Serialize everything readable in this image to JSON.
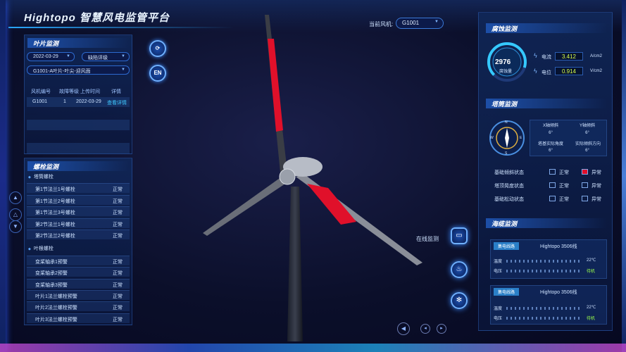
{
  "app": {
    "title": "Hightopo 智慧风电监管平台"
  },
  "turbine_selector": {
    "label": "当前风机:",
    "value": "G1001"
  },
  "blade_panel": {
    "title": "叶片监测",
    "date_value": "2022-03-29",
    "fault_value": "缺陷评级",
    "blade_select": "G1001-A叶片-叶尖-迎风面",
    "columns": [
      "风机编号",
      "故障等级",
      "上传时间",
      "详情"
    ],
    "rows": [
      {
        "id": "G1001",
        "level": "1",
        "time": "2022-03-29",
        "detail": "查看详情"
      }
    ]
  },
  "bolt_panel": {
    "title": "螺栓监测",
    "tower_section": "塔筒螺栓",
    "tower_rows": [
      {
        "name": "第1节法兰1号螺栓",
        "status": "正常"
      },
      {
        "name": "第1节法兰2号螺栓",
        "status": "正常"
      },
      {
        "name": "第1节法兰3号螺栓",
        "status": "正常"
      },
      {
        "name": "第2节法兰1号螺栓",
        "status": "正常"
      },
      {
        "name": "第2节法兰2号螺栓",
        "status": "正常"
      }
    ],
    "blade_section": "叶根螺栓",
    "blade_rows": [
      {
        "name": "变桨轴承1预警",
        "status": "正常"
      },
      {
        "name": "变桨轴承2预警",
        "status": "正常"
      },
      {
        "name": "变桨轴承3预警",
        "status": "正常"
      },
      {
        "name": "叶片1法兰螺栓预警",
        "status": "正常"
      },
      {
        "name": "叶片2法兰螺栓预警",
        "status": "正常"
      },
      {
        "name": "叶片3法兰螺栓预警",
        "status": "正常"
      }
    ]
  },
  "tool_buttons": {
    "refresh": "⟳",
    "lang": "EN"
  },
  "corrosion_panel": {
    "title": "腐蚀监测",
    "gauge_value": "2976",
    "gauge_label": "腐蚀量",
    "current_label": "电流",
    "current_value": "3.412",
    "current_unit": "A/cm2",
    "potential_label": "电位",
    "potential_value": "0.914",
    "potential_unit": "V/cm2"
  },
  "tower_panel": {
    "title": "塔筒监测",
    "tilt_headers": [
      "X轴倾斜",
      "Y轴倾斜"
    ],
    "tilt_values": [
      "6°",
      "6°"
    ],
    "angle_headers": [
      "塔基实际角度",
      "实际倾斜方向"
    ],
    "angle_values": [
      "6°",
      "6°"
    ],
    "compass": {
      "n": "N",
      "s": "S",
      "e": "E",
      "w": "W"
    },
    "status_rows": [
      {
        "name": "基础倾斜状态",
        "ok": "正常",
        "bad": "异常"
      },
      {
        "name": "塔顶晃度状态",
        "ok": "正常",
        "bad": "异常"
      },
      {
        "name": "基础松动状态",
        "ok": "正常",
        "bad": "异常"
      }
    ]
  },
  "cable_panel": {
    "title": "海缆监测",
    "cards": [
      {
        "tag": "集电线路",
        "name": "Hightopo 3506线",
        "temp_label": "温度",
        "temp_value": "22℃",
        "volt_label": "电压",
        "volt_value": "待机"
      },
      {
        "tag": "集电线路",
        "name": "Hightopo 3506线",
        "temp_label": "温度",
        "temp_value": "22℃",
        "volt_label": "电压",
        "volt_value": "待机"
      }
    ]
  },
  "online_monitor": {
    "label": "在线监测"
  },
  "colors": {
    "accent": "#2aa8ff",
    "blade_red": "#e0102a",
    "ok_green": "#9aff4a"
  }
}
